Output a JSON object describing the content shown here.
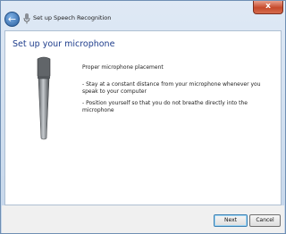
{
  "window": {
    "title": "Set up Speech Recognition",
    "close_label": "x"
  },
  "page": {
    "heading": "Set up your microphone",
    "section_title": "Proper microphone placement",
    "bullets": [
      "- Stay at a constant distance from your microphone whenever you speak to your computer",
      "- Position yourself so that you do not breathe directly into the microphone"
    ]
  },
  "buttons": {
    "next": "Next",
    "cancel": "Cancel"
  },
  "icons": {
    "back": "back-arrow-icon",
    "app": "microphone-small-icon",
    "illustration": "handheld-microphone-illustration"
  }
}
